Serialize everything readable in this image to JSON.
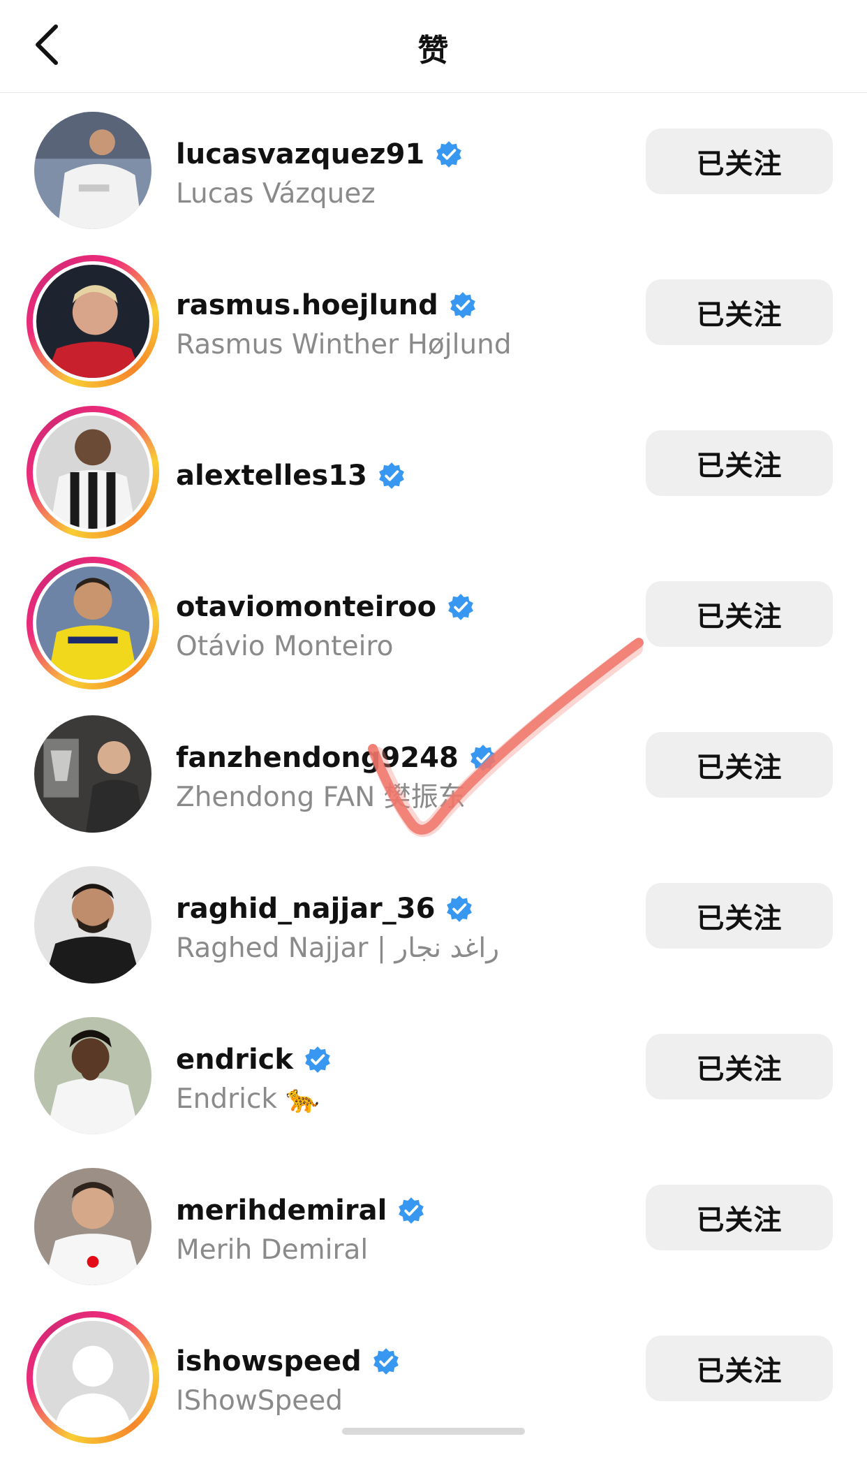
{
  "header": {
    "title": "赞",
    "back_icon": "chevron-left-icon"
  },
  "colors": {
    "verified_badge": "#3897f0",
    "follow_button_bg": "#efefef",
    "secondary_text": "#8a8a8a",
    "story_ring": [
      "#f9ce34",
      "#ee2a7b",
      "#6228d7"
    ],
    "annotation_check": "#f06a5e"
  },
  "users": [
    {
      "username": "lucasvazquez91",
      "full_name": "Lucas Vázquez",
      "verified": true,
      "story_ring": false,
      "button_label": "已关注"
    },
    {
      "username": "rasmus.hoejlund",
      "full_name": "Rasmus Winther Højlund",
      "verified": true,
      "story_ring": true,
      "button_label": "已关注"
    },
    {
      "username": "alextelles13",
      "full_name": "",
      "verified": true,
      "story_ring": true,
      "button_label": "已关注"
    },
    {
      "username": "otaviomonteiroo",
      "full_name": "Otávio Monteiro",
      "verified": true,
      "story_ring": true,
      "button_label": "已关注"
    },
    {
      "username": "fanzhendong9248",
      "full_name": "Zhendong FAN 樊振东",
      "verified": true,
      "story_ring": false,
      "button_label": "已关注"
    },
    {
      "username": "raghid_najjar_36",
      "full_name": "Raghed Najjar | راغد نجار",
      "verified": true,
      "story_ring": false,
      "button_label": "已关注"
    },
    {
      "username": "endrick",
      "full_name": "Endrick 🐆",
      "verified": true,
      "story_ring": false,
      "button_label": "已关注"
    },
    {
      "username": "merihdemiral",
      "full_name": "Merih Demiral",
      "verified": true,
      "story_ring": false,
      "button_label": "已关注"
    },
    {
      "username": "ishowspeed",
      "full_name": "IShowSpeed",
      "verified": true,
      "story_ring": true,
      "button_label": "已关注"
    }
  ]
}
